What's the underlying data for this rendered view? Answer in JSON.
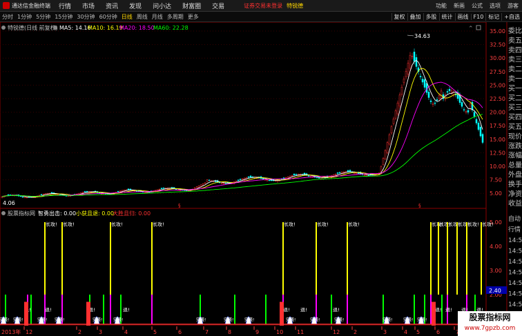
{
  "app": {
    "title": "通达信金融终端",
    "menus": [
      "行情",
      "市场",
      "资讯",
      "发现",
      "问小达",
      "财富圈",
      "交易"
    ],
    "notice": "证券交易未登录",
    "stock_name": "特锐德",
    "right_menus": [
      "功能",
      "新画",
      "公式",
      "选项"
    ],
    "guest": "游客"
  },
  "toolbar": {
    "periods": [
      "分时",
      "1分钟",
      "5分钟",
      "15分钟",
      "30分钟",
      "60分钟",
      "日线",
      "周线",
      "月线",
      "多周期",
      "更多"
    ],
    "active_period": "日线",
    "tools": [
      "复权",
      "叠加",
      "多股",
      "统计",
      "画线",
      "F10",
      "标记",
      "+自选"
    ]
  },
  "main_chart": {
    "header": "特锐德(日线 前复权)",
    "ma": [
      {
        "label": "MA5: 14.16",
        "color": "#ffffff"
      },
      {
        "label": "MA10: 16.19",
        "color": "#ffff00"
      },
      {
        "label": "MA20: 18.50",
        "color": "#ff00ff"
      },
      {
        "label": "MA60: 22.28",
        "color": "#00ff00"
      }
    ],
    "y_ticks": [
      "35.00",
      "32.50",
      "30.00",
      "27.50",
      "25.00",
      "22.50",
      "20.00",
      "17.50",
      "15.00",
      "12.50",
      "10.00",
      "7.50",
      "5.00"
    ],
    "left_labels": {
      "low": "4.06"
    },
    "peak_label": "34.63"
  },
  "indicator": {
    "header": "股票指标网",
    "fields": [
      {
        "label": "智勇出击: 0.00",
        "color": "#ffffff"
      },
      {
        "label": "小获且退: 0.00",
        "color": "#ffff00"
      },
      {
        "label": "大胜且归: 0.00",
        "color": "#ff3030"
      }
    ],
    "y_ticks": [
      "5.00",
      "4.00",
      "3.00",
      "2.00",
      "1.00"
    ],
    "current_value": "2.40",
    "bar_labels": {
      "attack": "长攻!",
      "retreat": "退!",
      "sudden": "突袭!"
    }
  },
  "x_axis": {
    "year_label": "2013年",
    "months": [
      "12",
      "2",
      "3",
      "4",
      "5",
      "6",
      "7",
      "8",
      "9",
      "10",
      "11",
      "12",
      "2",
      "3",
      "4",
      "5",
      "6",
      "7",
      "8"
    ]
  },
  "side_panel": {
    "items": [
      "委比",
      "卖五",
      "卖四",
      "卖三",
      "卖二",
      "卖一",
      "买一",
      "买二",
      "买三",
      "买四",
      "买五",
      "现价",
      "涨跌",
      "涨幅",
      "总量",
      "外盘",
      "换手",
      "净资",
      "收益"
    ],
    "lower_items": [
      "自动",
      "行情",
      "14:50",
      "14:50",
      "14:50",
      "14:50",
      "14:50",
      "14:50",
      "14:50",
      "14:50"
    ]
  },
  "watermark": {
    "title": "股票指标网",
    "url": "www.7gpzb.com"
  },
  "colors": {
    "up": "#ff3030",
    "down": "#00ffff",
    "ma5": "#ffffff",
    "ma10": "#ffff00",
    "ma20": "#ff00ff",
    "ma60": "#00ff00",
    "grid": "#8b0000",
    "axis_text": "#ff4040"
  }
}
